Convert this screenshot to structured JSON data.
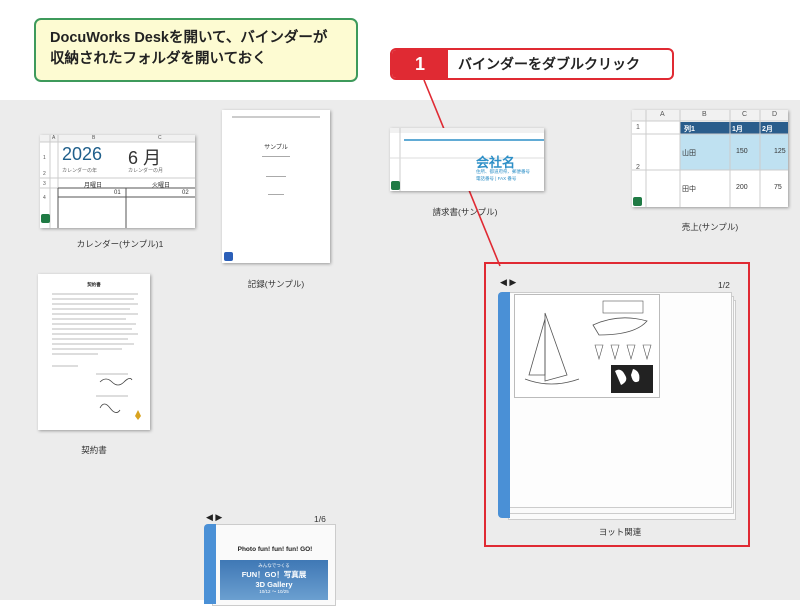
{
  "callout": {
    "line1": "DocuWorks Deskを開いて、バインダーが",
    "line2": "収納されたフォルダを開いておく"
  },
  "step": {
    "number": "1",
    "text": "バインダーをダブルクリック"
  },
  "colors": {
    "accent_red": "#e02a33",
    "callout_border": "#3e9a5b",
    "callout_bg": "#fdfbd2",
    "binder_blue": "#4a90d6"
  },
  "docs": {
    "calendar": {
      "caption": "カレンダー(サンプル)1",
      "cols": [
        "A",
        "B",
        "C"
      ],
      "rows": [
        "1",
        "2",
        "3",
        "4"
      ],
      "year": "2026",
      "year_label": "カレンダーの年",
      "month": "6 月",
      "month_label": "カレンダーの月",
      "day1": "月曜日",
      "day2": "火曜日",
      "date1": "01",
      "date2": "02"
    },
    "memo": {
      "caption": "記録(サンプル)",
      "title": "サンプル"
    },
    "invoice": {
      "caption": "請求書(サンプル)",
      "company": "会社名",
      "address1": "住所、都道府県、郵便番号",
      "address2": "電話番号 | FAX 番号"
    },
    "sales": {
      "caption": "売上(サンプル)",
      "cols": [
        "A",
        "B",
        "C",
        "D"
      ],
      "rows": [
        "1",
        "2"
      ],
      "headers": [
        "列1",
        "1月",
        "2月"
      ],
      "data": [
        [
          "山田",
          "150",
          "125"
        ],
        [
          "田中",
          "200",
          "75"
        ]
      ]
    },
    "contract": {
      "caption": "契約書",
      "title": "契約書"
    },
    "yacht": {
      "caption": "ヨット関連",
      "nav": "◀ ▶",
      "page": "1/2"
    },
    "gallery": {
      "nav": "◀ ▶",
      "page": "1/6",
      "headline": "Photo fun! fun! fun! GO!",
      "banner1": "みんなでつくる",
      "banner2": "FUN！GO！写真展",
      "banner3": "3D Gallery",
      "banner4": "10/12 〜 10/25"
    }
  }
}
